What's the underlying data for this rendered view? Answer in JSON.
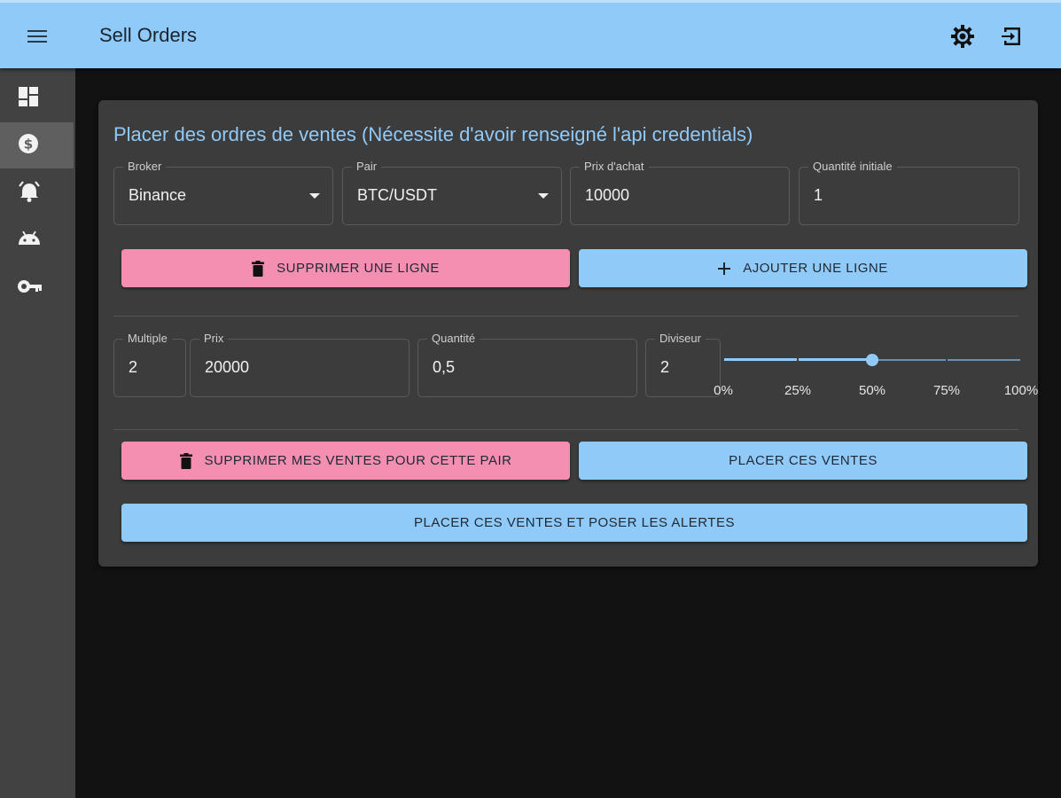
{
  "appbar": {
    "title": "Sell Orders",
    "menu_icon": "menu-icon",
    "settings_icon": "gear-icon",
    "logout_icon": "logout-icon",
    "color": "#90caf9"
  },
  "sidebar": {
    "items": [
      {
        "icon": "dashboard-icon",
        "active": false
      },
      {
        "icon": "dollar-icon",
        "active": true
      },
      {
        "icon": "alarm-icon",
        "active": false
      },
      {
        "icon": "android-icon",
        "active": false
      },
      {
        "icon": "key-icon",
        "active": false
      }
    ]
  },
  "form": {
    "title": "Placer des ordres de ventes (Nécessite d'avoir renseigné l'api credentials)",
    "broker": {
      "label": "Broker",
      "value": "Binance"
    },
    "pair": {
      "label": "Pair",
      "value": "BTC/USDT"
    },
    "buy_price": {
      "label": "Prix d'achat",
      "value": "10000"
    },
    "initial_quantity": {
      "label": "Quantité initiale",
      "value": "1"
    },
    "delete_row_label": "SUPPRIMER UNE LIGNE",
    "add_row_label": "AJOUTER UNE LIGNE",
    "row": {
      "multiple": {
        "label": "Multiple",
        "value": "2"
      },
      "price": {
        "label": "Prix",
        "value": "20000"
      },
      "quantity": {
        "label": "Quantité",
        "value": "0,5"
      },
      "divisor": {
        "label": "Diviseur",
        "value": "2"
      },
      "slider": {
        "value_percent": 50,
        "marks": [
          "0%",
          "25%",
          "50%",
          "75%",
          "100%"
        ]
      }
    },
    "delete_sales_label": "SUPPRIMER MES VENTES POUR CETTE PAIR",
    "place_sales_label": "PLACER CES VENTES",
    "place_sales_alerts_label": "PLACER CES VENTES ET POSER LES ALERTES"
  },
  "colors": {
    "primary": "#90caf9",
    "secondary": "#f48fb1",
    "background": "#121212",
    "card": "#3c3c3c"
  }
}
